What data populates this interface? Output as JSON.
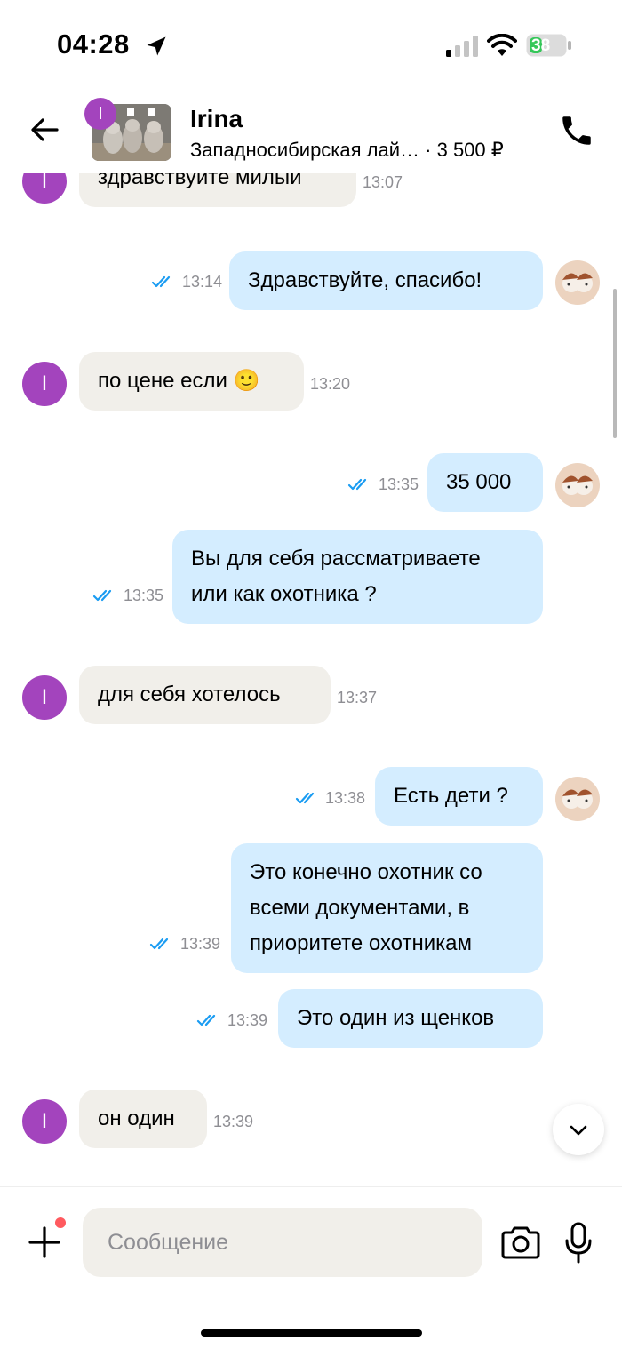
{
  "status_bar": {
    "time": "04:28",
    "battery": "38",
    "battery_fraction": 0.38
  },
  "header": {
    "avatar_initial": "I",
    "contact_name": "Irina",
    "listing_title": "Западносибирская лай…",
    "listing_price": " · 3 500 ₽"
  },
  "messages": [
    {
      "direction": "in",
      "text": "здравствуйте милый",
      "time": "13:07"
    },
    {
      "direction": "out",
      "text": "Здравствуйте, спасибо!",
      "time": "13:14"
    },
    {
      "direction": "in",
      "text": "по цене если 🙂",
      "time": "13:20"
    },
    {
      "direction": "out",
      "text": "35 000",
      "time": "13:35"
    },
    {
      "direction": "out",
      "lines": [
        "Вы для себя рассматриваете",
        "или как охотника ?"
      ],
      "time": "13:35"
    },
    {
      "direction": "in",
      "text": "для себя хотелось",
      "time": "13:37"
    },
    {
      "direction": "out",
      "text": "Есть дети ?",
      "time": "13:38"
    },
    {
      "direction": "out",
      "lines": [
        "Это конечно охотник со",
        "всеми документами, в",
        "приоритете охотникам"
      ],
      "time": "13:39"
    },
    {
      "direction": "out",
      "text": "Это один из щенков",
      "time": "13:39"
    },
    {
      "direction": "in",
      "text": "он один",
      "time": "13:39"
    }
  ],
  "composer": {
    "placeholder": "Сообщение"
  },
  "colors": {
    "accent": "#a344bd",
    "out_bubble": "#d4edff",
    "in_bubble": "#f1efea",
    "read_check": "#1a9cf2"
  },
  "icons": [
    "location-arrow-icon",
    "signal-icon",
    "wifi-icon",
    "battery-icon",
    "back-arrow-icon",
    "phone-icon",
    "double-check-icon",
    "chevron-down-icon",
    "plus-icon",
    "camera-icon",
    "microphone-icon"
  ]
}
